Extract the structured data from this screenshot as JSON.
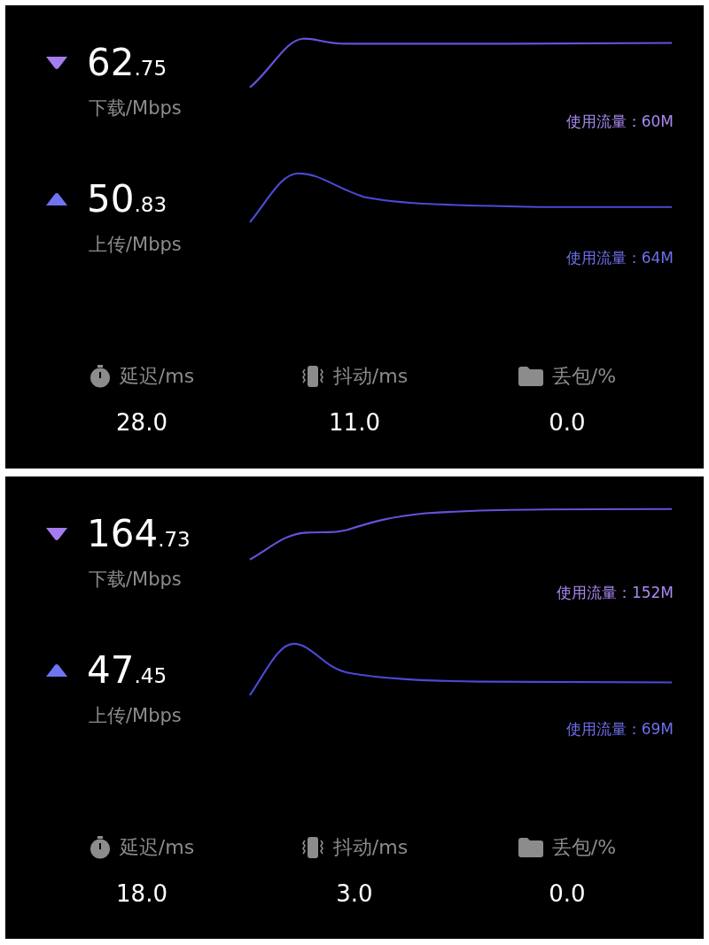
{
  "panels": [
    {
      "rows": [
        {
          "kind": "download",
          "integer": "62",
          "decimal": ".75",
          "unit": "下载/Mbps",
          "usage": "使用流量：60M"
        },
        {
          "kind": "upload",
          "integer": "50",
          "decimal": ".83",
          "unit": "上传/Mbps",
          "usage": "使用流量：64M"
        }
      ],
      "stats": [
        {
          "kind": "latency",
          "label": "延迟/ms",
          "value": "28.0"
        },
        {
          "kind": "jitter",
          "label": "抖动/ms",
          "value": "11.0"
        },
        {
          "kind": "loss",
          "label": "丢包/%",
          "value": "0.0"
        }
      ]
    },
    {
      "rows": [
        {
          "kind": "download",
          "integer": "164",
          "decimal": ".73",
          "unit": "下载/Mbps",
          "usage": "使用流量：152M"
        },
        {
          "kind": "upload",
          "integer": "47",
          "decimal": ".45",
          "unit": "上传/Mbps",
          "usage": "使用流量：69M"
        }
      ],
      "stats": [
        {
          "kind": "latency",
          "label": "延迟/ms",
          "value": "18.0"
        },
        {
          "kind": "jitter",
          "label": "抖动/ms",
          "value": "3.0"
        },
        {
          "kind": "loss",
          "label": "丢包/%",
          "value": "0.0"
        }
      ]
    }
  ]
}
